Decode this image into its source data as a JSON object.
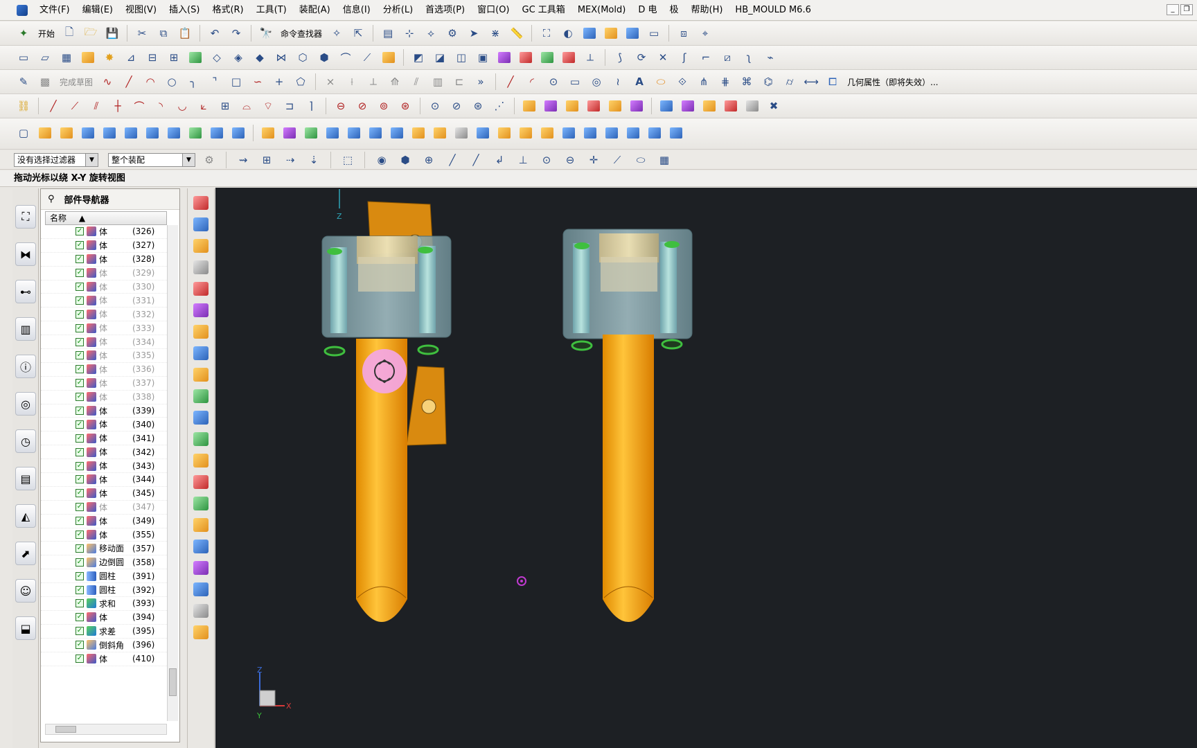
{
  "menu": [
    "文件(F)",
    "编辑(E)",
    "视图(V)",
    "插入(S)",
    "格式(R)",
    "工具(T)",
    "装配(A)",
    "信息(I)",
    "分析(L)",
    "首选项(P)",
    "窗口(O)",
    "GC 工具箱",
    "MEX(Mold)",
    "D 电",
    "极",
    "帮助(H)",
    "HB_MOULD M6.6"
  ],
  "toolbar": {
    "start_label": "开始",
    "command_finder_label": "命令查找器",
    "finish_sketch_label": "完成草图",
    "geometry_props_label": "几何属性（即将失效）..."
  },
  "filter": {
    "selection_filter": "没有选择过滤器",
    "assembly_scope": "整个装配"
  },
  "status_message": "拖动光标以绕 X-Y 旋转视图",
  "navigator": {
    "title": "部件导航器",
    "column_header": "名称",
    "rows": [
      {
        "name": "体",
        "id": "(326)",
        "type": "body",
        "dim": false
      },
      {
        "name": "体",
        "id": "(327)",
        "type": "body",
        "dim": false
      },
      {
        "name": "体",
        "id": "(328)",
        "type": "body",
        "dim": false
      },
      {
        "name": "体",
        "id": "(329)",
        "type": "body",
        "dim": true
      },
      {
        "name": "体",
        "id": "(330)",
        "type": "body",
        "dim": true
      },
      {
        "name": "体",
        "id": "(331)",
        "type": "body",
        "dim": true
      },
      {
        "name": "体",
        "id": "(332)",
        "type": "body",
        "dim": true
      },
      {
        "name": "体",
        "id": "(333)",
        "type": "body",
        "dim": true
      },
      {
        "name": "体",
        "id": "(334)",
        "type": "body",
        "dim": true
      },
      {
        "name": "体",
        "id": "(335)",
        "type": "body",
        "dim": true
      },
      {
        "name": "体",
        "id": "(336)",
        "type": "body",
        "dim": true
      },
      {
        "name": "体",
        "id": "(337)",
        "type": "body",
        "dim": true
      },
      {
        "name": "体",
        "id": "(338)",
        "type": "body",
        "dim": true
      },
      {
        "name": "体",
        "id": "(339)",
        "type": "body",
        "dim": false
      },
      {
        "name": "体",
        "id": "(340)",
        "type": "body",
        "dim": false
      },
      {
        "name": "体",
        "id": "(341)",
        "type": "body",
        "dim": false
      },
      {
        "name": "体",
        "id": "(342)",
        "type": "body",
        "dim": false
      },
      {
        "name": "体",
        "id": "(343)",
        "type": "body",
        "dim": false
      },
      {
        "name": "体",
        "id": "(344)",
        "type": "body",
        "dim": false
      },
      {
        "name": "体",
        "id": "(345)",
        "type": "body",
        "dim": false
      },
      {
        "name": "体",
        "id": "(347)",
        "type": "body",
        "dim": true
      },
      {
        "name": "体",
        "id": "(349)",
        "type": "body",
        "dim": false
      },
      {
        "name": "体",
        "id": "(355)",
        "type": "body",
        "dim": false
      },
      {
        "name": "移动面",
        "id": "(357)",
        "type": "feature",
        "dim": false
      },
      {
        "name": "边倒圆",
        "id": "(358)",
        "type": "feature",
        "dim": false
      },
      {
        "name": "圆柱",
        "id": "(391)",
        "type": "cylinder",
        "dim": false
      },
      {
        "name": "圆柱",
        "id": "(392)",
        "type": "cylinder",
        "dim": false
      },
      {
        "name": "求和",
        "id": "(393)",
        "type": "boolean",
        "dim": false
      },
      {
        "name": "体",
        "id": "(394)",
        "type": "body",
        "dim": false
      },
      {
        "name": "求差",
        "id": "(395)",
        "type": "boolean",
        "dim": false
      },
      {
        "name": "倒斜角",
        "id": "(396)",
        "type": "feature",
        "dim": false
      },
      {
        "name": "体",
        "id": "(410)",
        "type": "body",
        "dim": false
      }
    ]
  },
  "viewport": {
    "triad_axis_z": "Z",
    "triad_axis_x": "X",
    "triad_axis_y": "Y",
    "colors": {
      "background": "#1d2024",
      "part_orange": "#f5a41a",
      "block_glass": "#8fb7c0",
      "pin_green": "#3fbf3f"
    }
  }
}
